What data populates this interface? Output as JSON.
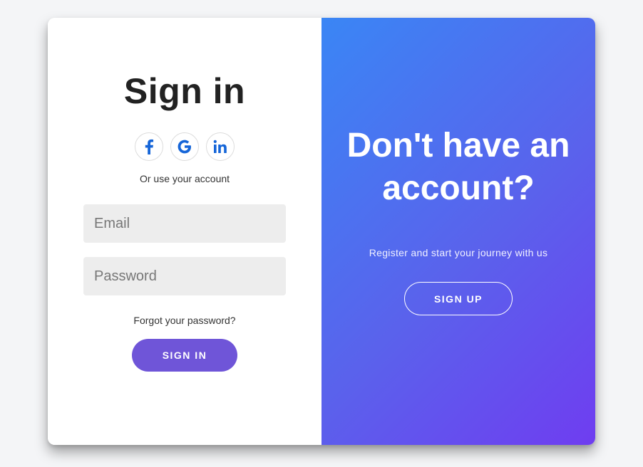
{
  "signin": {
    "title": "Sign in",
    "social": [
      {
        "name": "facebook-icon",
        "glyph": "f"
      },
      {
        "name": "google-icon",
        "glyph": "G"
      },
      {
        "name": "linkedin-icon",
        "glyph": "in"
      }
    ],
    "alt_text": "Or use your account",
    "email_placeholder": "Email",
    "password_placeholder": "Password",
    "forgot_label": "Forgot your password?",
    "button_label": "SIGN IN"
  },
  "promo": {
    "title": "Don't have an account?",
    "text": "Register and start your journey with us",
    "button_label": "SIGN UP"
  },
  "colors": {
    "accent": "#6f55d8",
    "gradient_start": "#3a86f5",
    "gradient_end": "#6f3df0",
    "social_icon": "#1565d8"
  }
}
